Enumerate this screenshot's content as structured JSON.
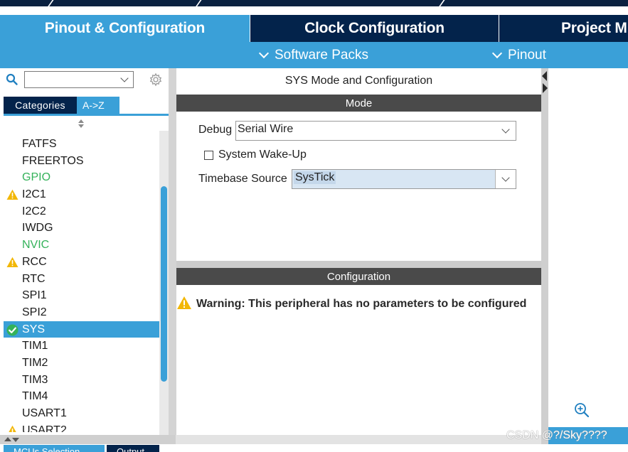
{
  "main_tabs": {
    "pinout_config": "Pinout & Configuration",
    "clock_config": "Clock Configuration",
    "project_manager": "Project M"
  },
  "sub_menu": {
    "software_packs": "Software Packs",
    "pinout": "Pinout"
  },
  "sidebar": {
    "search_value": "",
    "tabs": {
      "categories": "Categories",
      "az": "A->Z"
    },
    "items": [
      {
        "label": "FATFS",
        "state": "normal"
      },
      {
        "label": "FREERTOS",
        "state": "normal"
      },
      {
        "label": "GPIO",
        "state": "green"
      },
      {
        "label": "I2C1",
        "state": "warning"
      },
      {
        "label": "I2C2",
        "state": "normal"
      },
      {
        "label": "IWDG",
        "state": "normal"
      },
      {
        "label": "NVIC",
        "state": "green"
      },
      {
        "label": "RCC",
        "state": "warning"
      },
      {
        "label": "RTC",
        "state": "normal"
      },
      {
        "label": "SPI1",
        "state": "normal"
      },
      {
        "label": "SPI2",
        "state": "normal"
      },
      {
        "label": "SYS",
        "state": "selected"
      },
      {
        "label": "TIM1",
        "state": "normal"
      },
      {
        "label": "TIM2",
        "state": "normal"
      },
      {
        "label": "TIM3",
        "state": "normal"
      },
      {
        "label": "TIM4",
        "state": "normal"
      },
      {
        "label": "USART1",
        "state": "normal"
      },
      {
        "label": "USART2",
        "state": "warning"
      }
    ],
    "bottom_tabs": {
      "mcu_selection": "MCUs Selection",
      "output": "Output"
    }
  },
  "main": {
    "title": "SYS Mode and Configuration",
    "mode_header": "Mode",
    "debug_label": "Debug",
    "debug_value": "Serial Wire",
    "wakeup_label": "System Wake-Up",
    "wakeup_checked": false,
    "timebase_label": "Timebase Source",
    "timebase_value": "SysTick",
    "config_header": "Configuration",
    "warning_text": "Warning: This peripheral has no parameters to be configured"
  },
  "watermark": "CSDN @?/Sky????",
  "colors": {
    "navy": "#03234b",
    "accent_blue": "#3aa0d8",
    "header_gray": "#4a4a4a",
    "ok_green": "#34b25a",
    "warning_yellow": "#f2b705"
  }
}
